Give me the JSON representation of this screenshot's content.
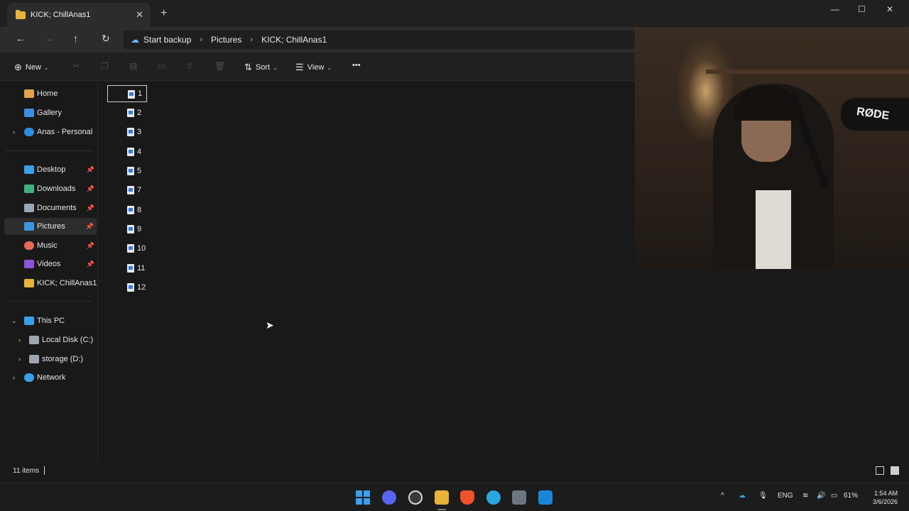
{
  "window": {
    "tab_title": "KICK; ChillAnas1",
    "tab_close": "✕",
    "new_tab": "+",
    "minimize": "—",
    "maximize": "☐",
    "close": "✕"
  },
  "address": {
    "back": "←",
    "forward": "→",
    "up": "↑",
    "refresh": "↻",
    "breadcrumbs": [
      "Start backup",
      "Pictures",
      "KICK; ChillAnas1"
    ],
    "separator": "›"
  },
  "commands": {
    "new_label": "New",
    "sort_label": "Sort",
    "view_label": "View",
    "more": "•••",
    "chevron": "⌄"
  },
  "sidebar": {
    "items": [
      {
        "label": "Home",
        "icon": "home-icon",
        "color": "#e2a44a"
      },
      {
        "label": "Gallery",
        "icon": "gallery-icon",
        "color": "#3b8fe0"
      },
      {
        "label": "Anas - Personal",
        "icon": "onedrive-icon",
        "color": "#2d8ee0"
      },
      {
        "label": "Desktop",
        "icon": "desktop-icon",
        "color": "#3aa0e8"
      },
      {
        "label": "Downloads",
        "icon": "downloads-icon",
        "color": "#3fb27f"
      },
      {
        "label": "Documents",
        "icon": "documents-icon",
        "color": "#9aa7b8"
      },
      {
        "label": "Pictures",
        "icon": "pictures-icon",
        "color": "#3a96e2"
      },
      {
        "label": "Music",
        "icon": "music-icon",
        "color": "#e36b58"
      },
      {
        "label": "Videos",
        "icon": "videos-icon",
        "color": "#8a55d6"
      },
      {
        "label": "KICK; ChillAnas1",
        "icon": "folder-icon",
        "color": "#e8b339"
      },
      {
        "label": "This PC",
        "icon": "pc-icon",
        "color": "#3aa0e8"
      },
      {
        "label": "Local Disk (C:)",
        "icon": "disk-icon",
        "color": "#9ea6b0"
      },
      {
        "label": "storage (D:)",
        "icon": "disk-icon",
        "color": "#9ea6b0"
      },
      {
        "label": "Network",
        "icon": "network-icon",
        "color": "#3aa0e8"
      }
    ],
    "pin": "📌",
    "expand": "›",
    "expanded": "⌄"
  },
  "files": [
    "1",
    "2",
    "3",
    "4",
    "5",
    "7",
    "8",
    "9",
    "10",
    "11",
    "12"
  ],
  "webcam": {
    "brand_text": "RØDE"
  },
  "status": {
    "items_count": "11 items"
  },
  "tray": {
    "language": "ENG",
    "battery": "61%",
    "time": "1:54 AM",
    "date": "3/6/2026",
    "chevron": "^"
  },
  "colors": {
    "accent": "#3aa0f0",
    "folder": "#e8b339"
  }
}
